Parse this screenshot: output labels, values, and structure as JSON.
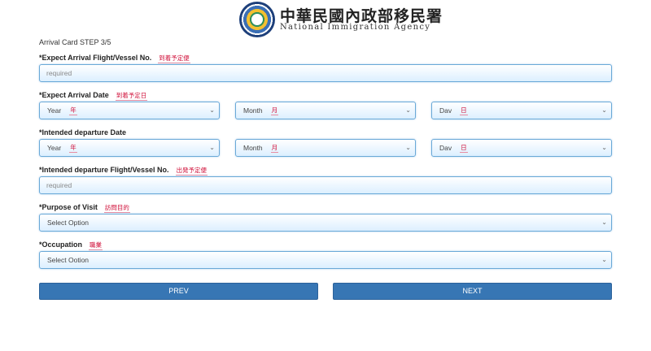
{
  "header": {
    "agency_zh": "中華民國內政部移民署",
    "agency_en": "National Immigration Agency",
    "logo_icon": "emblem-logo-icon"
  },
  "step": "Arrival Card STEP 3/5",
  "fields": {
    "flight": {
      "label": "*Expect Arrival Flight/Vessel No.",
      "jp": "到着予定便",
      "placeholder": "required"
    },
    "arrival_date": {
      "label": "*Expect Arrival Date",
      "jp": "到着予定日",
      "year": {
        "text": "Year",
        "jp": "年"
      },
      "month": {
        "text": "Month",
        "jp": "月"
      },
      "day": {
        "text": "Dav",
        "jp": "日"
      }
    },
    "departure_date": {
      "label": "*Intended departure Date",
      "year": {
        "text": "Year",
        "jp": "年"
      },
      "month": {
        "text": "Month",
        "jp": "月"
      },
      "day": {
        "text": "Dav",
        "jp": "日"
      }
    },
    "departure_flight": {
      "label": "*Intended departure Flight/Vessel No.",
      "jp": "出発予定便",
      "placeholder": "required"
    },
    "purpose": {
      "label": "*Purpose of Visit",
      "jp": "訪問目的",
      "value": "Select Option"
    },
    "occupation": {
      "label": "*Occupation",
      "jp": "職業",
      "value": "Select Ootion"
    }
  },
  "buttons": {
    "prev": "PREV",
    "next": "NEXT"
  },
  "icons": {
    "chevron": "chevron-down-icon"
  },
  "colors": {
    "button": "#3776b4",
    "field_border": "#6aa9d8",
    "jp_label": "#d0103a"
  }
}
